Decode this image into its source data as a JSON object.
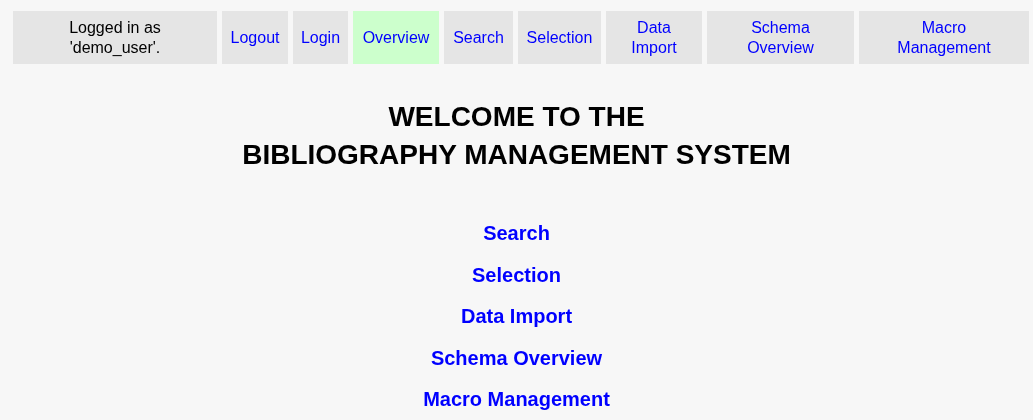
{
  "nav": {
    "status": "Logged in as 'demo_user'.",
    "items": [
      {
        "label": "Logout",
        "selected": false
      },
      {
        "label": "Login",
        "selected": false
      },
      {
        "label": "Overview",
        "selected": true
      },
      {
        "label": "Search",
        "selected": false
      },
      {
        "label": "Selection",
        "selected": false
      },
      {
        "label": "Data Import",
        "selected": false
      },
      {
        "label": "Schema Overview",
        "selected": false
      },
      {
        "label": "Macro Management",
        "selected": false
      }
    ]
  },
  "title_lines": [
    "WELCOME TO THE",
    "BIBLIOGRAPHY MANAGEMENT SYSTEM"
  ],
  "links": [
    "Search",
    "Selection",
    "Data Import",
    "Schema Overview",
    "Macro Management"
  ]
}
